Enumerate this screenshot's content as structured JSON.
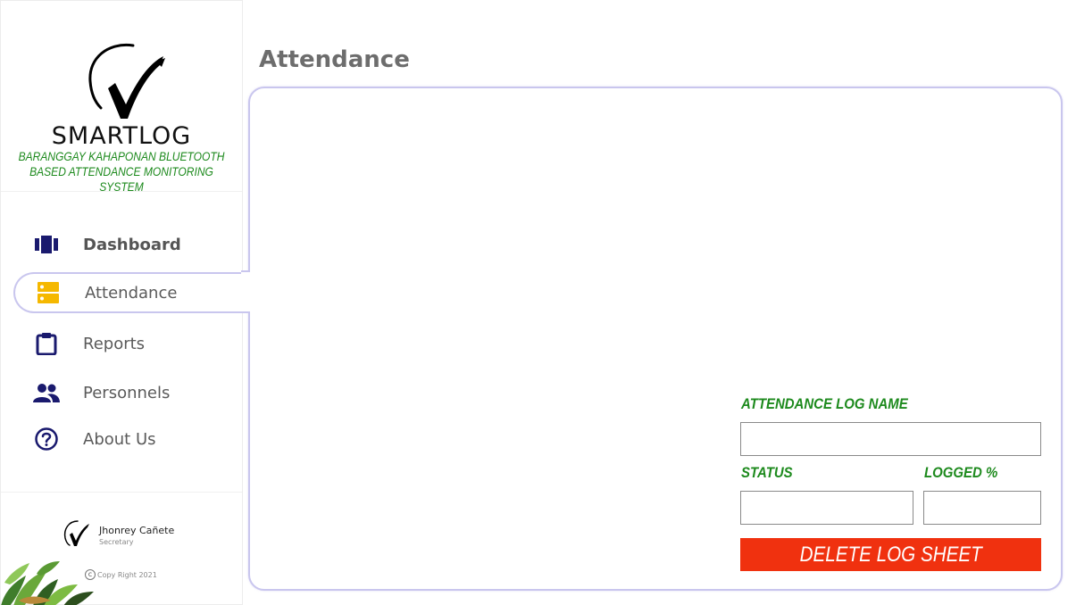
{
  "brand": {
    "name": "SMARTLOG",
    "tagline_line1": "BARANGGAY KAHAPONAN BLUETOOTH",
    "tagline_line2": "BASED ATTENDANCE MONITORING SYSTEM",
    "logo_icon": "checkmark-logo"
  },
  "sidebar": {
    "items": [
      {
        "label": "Dashboard",
        "icon": "dashboard-icon",
        "color": "#1a1a6e"
      },
      {
        "label": "Attendance",
        "icon": "attendance-icon",
        "color": "#f5b800",
        "active": true
      },
      {
        "label": "Reports",
        "icon": "clipboard-icon",
        "color": "#1a1a6e"
      },
      {
        "label": "Personnels",
        "icon": "people-icon",
        "color": "#1a1a6e"
      },
      {
        "label": "About Us",
        "icon": "help-icon",
        "color": "#1a1a6e"
      }
    ]
  },
  "user": {
    "name": "Jhonrey Cañete",
    "role": "Secretary"
  },
  "copyright": "Copy Right 2021",
  "main": {
    "title": "Attendance",
    "form": {
      "log_name_label": "ATTENDANCE LOG NAME",
      "log_name_value": "",
      "status_label": "STATUS",
      "status_value": "",
      "logged_label": "LOGGED %",
      "logged_value": "",
      "delete_button": "DELETE LOG SHEET"
    }
  },
  "colors": {
    "accent_green": "#1d8a1d",
    "panel_border": "#c9c6ee",
    "danger": "#f0310f",
    "nav_icon": "#1a1a6e",
    "active_icon": "#f5b800"
  }
}
